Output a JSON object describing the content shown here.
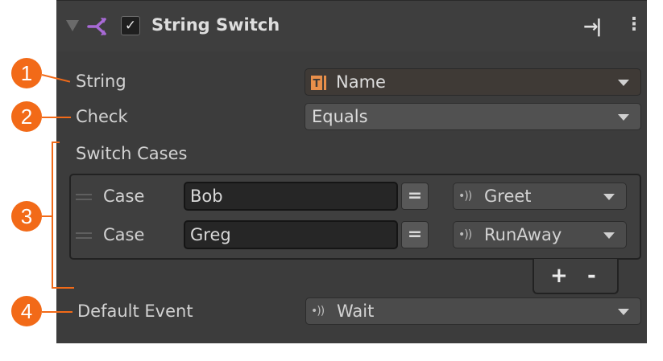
{
  "header": {
    "title": "String Switch",
    "checked_glyph": "✓",
    "pin_glyph": "→|",
    "more_glyph": "⋮"
  },
  "fields": {
    "string_label": "String",
    "string_value": "Name",
    "check_label": "Check",
    "check_value": "Equals"
  },
  "switch_cases": {
    "label": "Switch Cases",
    "cases": [
      {
        "label": "Case",
        "value": "Bob",
        "compare_glyph": "=",
        "event": "Greet"
      },
      {
        "label": "Case",
        "value": "Greg",
        "compare_glyph": "=",
        "event": "RunAway"
      }
    ],
    "add_glyph": "+",
    "remove_glyph": "-"
  },
  "default_event": {
    "label": "Default Event",
    "value": "Wait"
  },
  "signal_glyph": "•))",
  "callouts": [
    "1",
    "2",
    "3",
    "4"
  ],
  "colors": {
    "panel_bg": "#3c3c3c",
    "accent_icon": "#a86ad6",
    "callout": "#f26a18",
    "string_field_tint": "#3f3a36",
    "string_type_icon": "#e98f4a"
  }
}
